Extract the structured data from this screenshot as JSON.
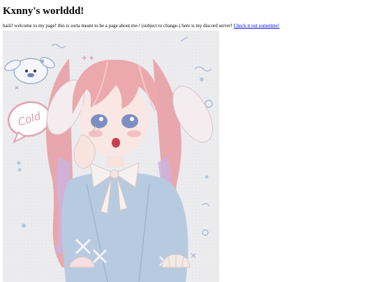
{
  "page": {
    "title": "Kxnny's worlddd!",
    "intro_text": "haiii! welcome to my page! this is sorta meant to be a page about me-! (subject to change-) here is my discord server!",
    "discord_link_label": "Check it out sometime!"
  },
  "artwork": {
    "speech_bubble_text": "Cold",
    "colors": {
      "background": "#ececef",
      "hair_pink": "#e7a3aa",
      "hair_lilac": "#c9b3dc",
      "sweater_blue": "#b4c9df",
      "skin": "#f8e7e2",
      "link_blue": "#0000ee"
    }
  }
}
